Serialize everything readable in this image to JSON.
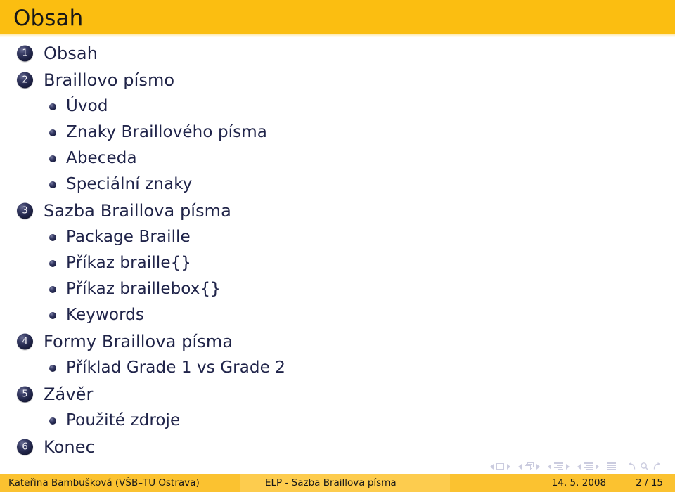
{
  "slide": {
    "title": "Obsah",
    "header_color": "#fbbe11",
    "text_color": "#1f2347"
  },
  "toc": {
    "items": [
      {
        "kind": "section",
        "number": "1",
        "label": "Obsah"
      },
      {
        "kind": "section",
        "number": "2",
        "label": "Braillovo písmo"
      },
      {
        "kind": "sub",
        "label": "Úvod"
      },
      {
        "kind": "sub",
        "label": "Znaky Braillového písma"
      },
      {
        "kind": "sub",
        "label": "Abeceda"
      },
      {
        "kind": "sub",
        "label": "Speciální znaky"
      },
      {
        "kind": "section",
        "number": "3",
        "label": "Sazba Braillova písma"
      },
      {
        "kind": "sub",
        "label": "Package Braille"
      },
      {
        "kind": "sub",
        "label": "Příkaz braille{}"
      },
      {
        "kind": "sub",
        "label": "Příkaz braillebox{}"
      },
      {
        "kind": "sub",
        "label": "Keywords"
      },
      {
        "kind": "section",
        "number": "4",
        "label": "Formy Braillova písma"
      },
      {
        "kind": "sub",
        "label": "Příklad Grade 1 vs Grade 2"
      },
      {
        "kind": "section",
        "number": "5",
        "label": "Závěr"
      },
      {
        "kind": "sub",
        "label": "Použité zdroje"
      },
      {
        "kind": "section",
        "number": "6",
        "label": "Konec"
      }
    ]
  },
  "navigation": {
    "groups": [
      {
        "icon": "slide-icon",
        "name": "slide"
      },
      {
        "icon": "frame-icon",
        "name": "frame"
      },
      {
        "icon": "subsection-icon",
        "name": "subsection"
      },
      {
        "icon": "section-icon",
        "name": "section"
      }
    ],
    "document_icon": "document-icon",
    "back_icon": "back-icon",
    "search_icon": "search-icon",
    "forward_icon": "forward-icon"
  },
  "footer": {
    "author": "Kateřina Bambušková  (VŠB–TU Ostrava)",
    "title": "ELP - Sazba Braillova písma",
    "date": "14. 5. 2008",
    "page": "2 / 15"
  }
}
